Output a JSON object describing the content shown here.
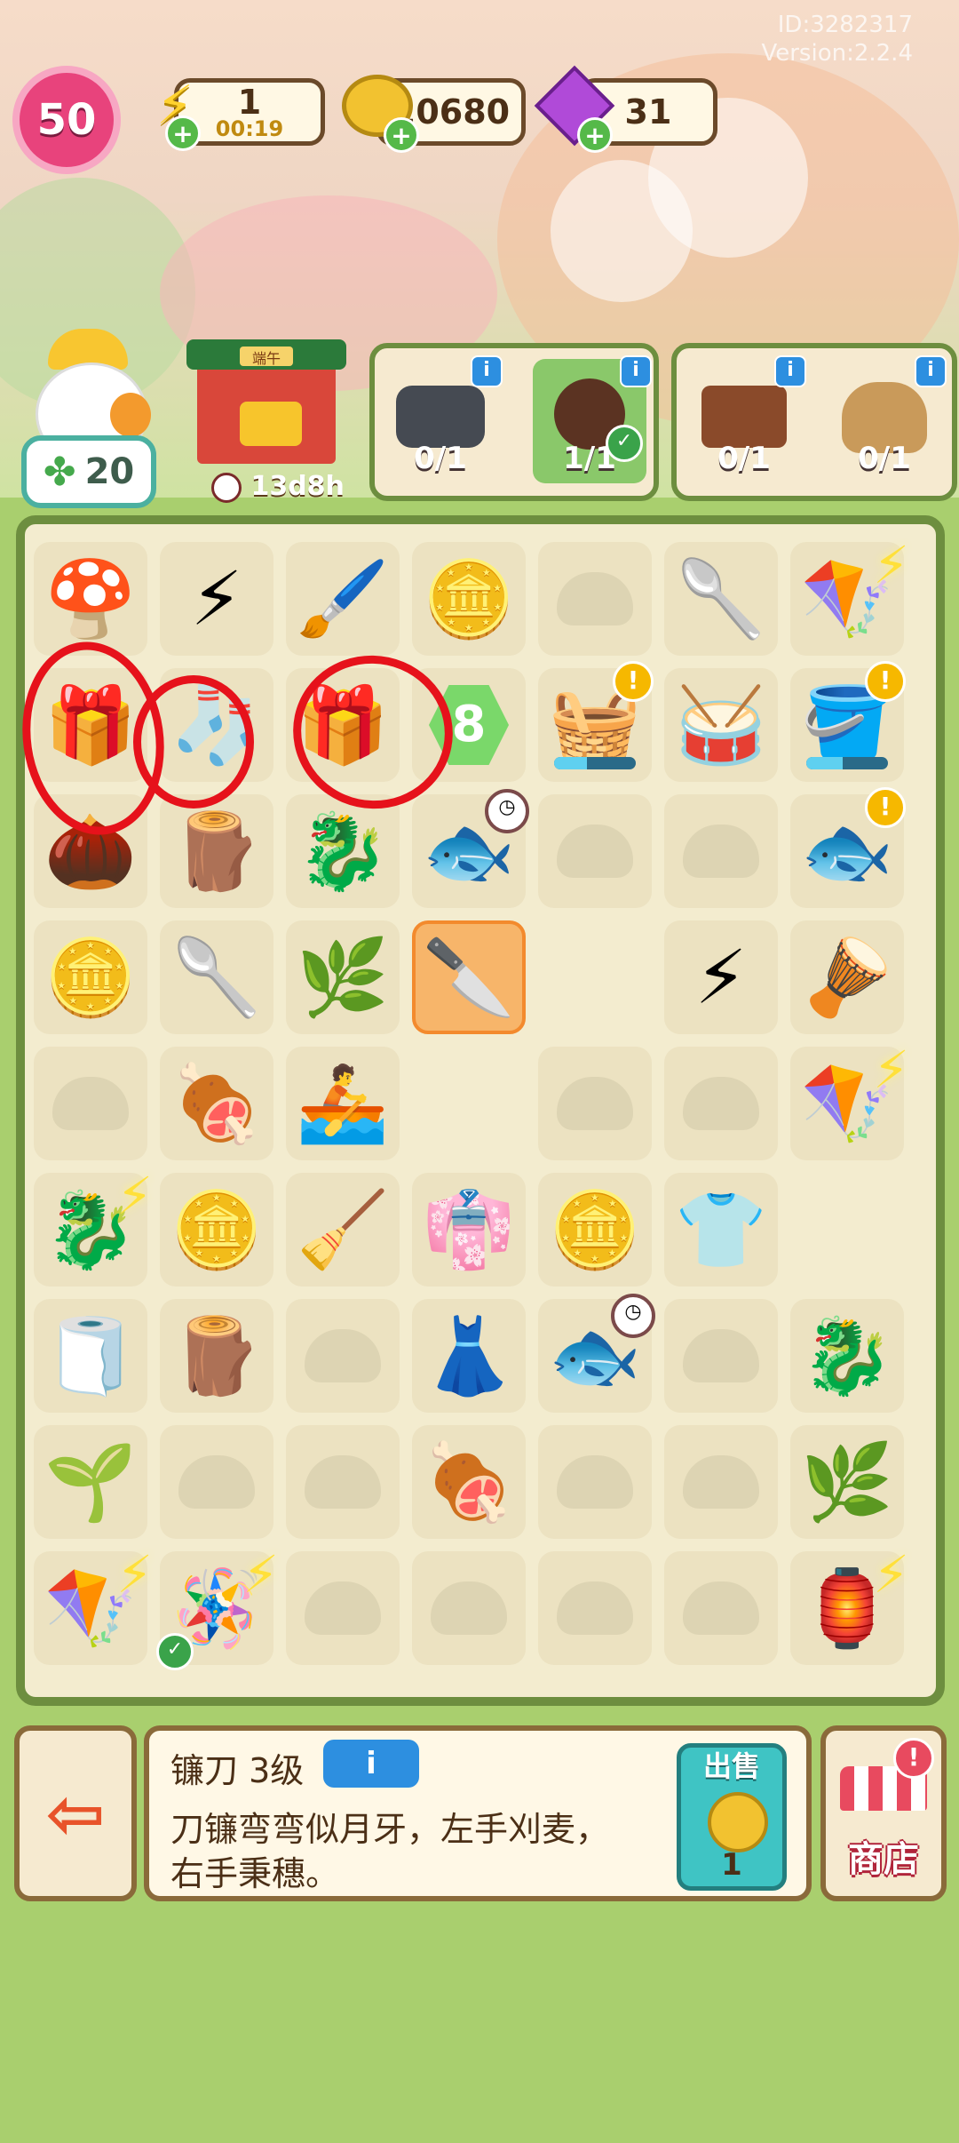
{
  "header": {
    "id_text": "ID:3282317",
    "version_text": "Version:2.2.4",
    "level": "50",
    "energy": {
      "value": "1",
      "timer": "00:19",
      "icon": "lightning-icon"
    },
    "coins": {
      "value": "20680",
      "icon": "coin-icon"
    },
    "gems": {
      "value": "31",
      "icon": "gem-icon"
    }
  },
  "clover": {
    "value": "20"
  },
  "event": {
    "timer": "13d8h",
    "sign": "端午"
  },
  "orders": [
    {
      "progress_a": "0/1",
      "progress_b": "1/1"
    },
    {
      "progress_a": "0/1",
      "progress_b": "0/1"
    }
  ],
  "board_items": [
    [
      "🍄",
      "⚡",
      "🖌️",
      "🪙",
      "",
      "🥄",
      "🪁"
    ],
    [
      "🎁",
      "🧦",
      "🎁",
      "8",
      "🧺",
      "🥁",
      "🪣"
    ],
    [
      "🌰",
      "🪵",
      "🐉",
      "🐟",
      "",
      "",
      "🐟"
    ],
    [
      "🪙",
      "🥄",
      "🌿",
      "🔪",
      "",
      "⚡",
      "🪘"
    ],
    [
      "",
      "🍖",
      "🚣",
      "",
      "",
      "",
      "🪁"
    ],
    [
      "🐉",
      "🪙",
      "🧹",
      "👘",
      "🪙",
      "👕",
      ""
    ],
    [
      "🧻",
      "🪵",
      "",
      "👗",
      "🐟",
      "",
      "🐉"
    ],
    [
      "🌱",
      "",
      "",
      "🍖",
      "",
      "",
      "🌿"
    ],
    [
      "🪁",
      "🪅",
      "",
      "",
      "",
      "",
      "🏮"
    ]
  ],
  "detail": {
    "title": "镰刀 3级",
    "info_label": "i",
    "description": "刀镰弯弯似月牙，左手刈麦，右手秉穗。",
    "sell_label": "出售",
    "sell_price": "1"
  },
  "shop": {
    "label": "商店"
  },
  "colors": {
    "board_border": "#6d8e3f",
    "highlight": "#e6121b",
    "selected": "#f7b56a"
  }
}
